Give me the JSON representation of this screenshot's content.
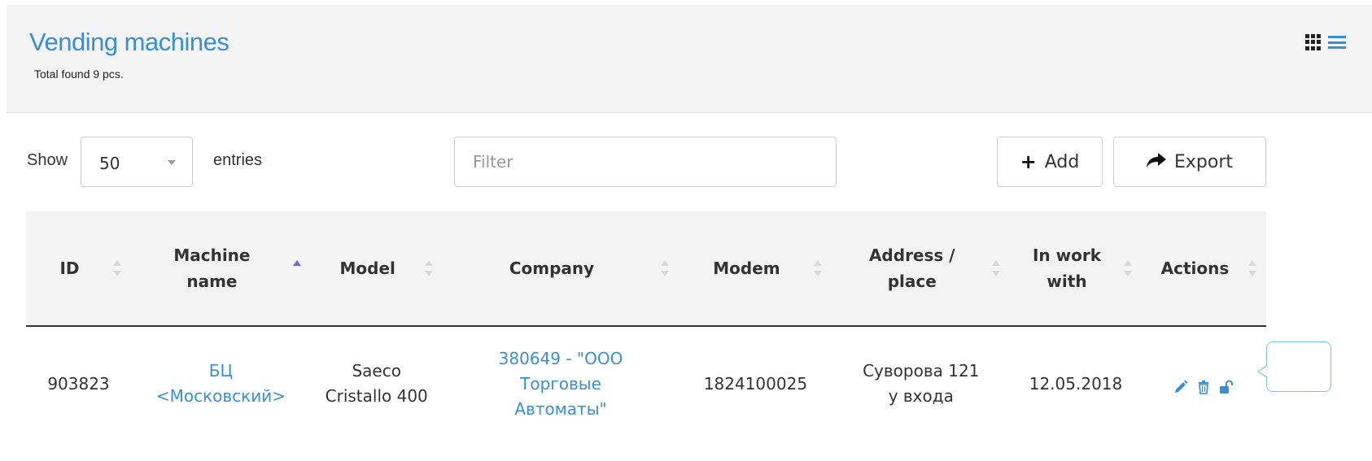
{
  "header": {
    "title": "Vending machines",
    "subtitle": "Total found 9 pcs.",
    "accent_color": "#3a8fd0"
  },
  "view_toggle": {
    "grid_icon": "grid-icon",
    "list_icon": "list-icon"
  },
  "toolbar": {
    "show_label": "Show",
    "page_size": "50",
    "entries_label": "entries",
    "filter_placeholder": "Filter",
    "add_label": "Add",
    "export_label": "Export"
  },
  "table": {
    "columns": [
      {
        "line1": "ID",
        "line2": "",
        "sort": "none"
      },
      {
        "line1": "Machine",
        "line2": "name",
        "sort": "asc"
      },
      {
        "line1": "Model",
        "line2": "",
        "sort": "none"
      },
      {
        "line1": "Company",
        "line2": "",
        "sort": "none"
      },
      {
        "line1": "Modem",
        "line2": "",
        "sort": "none"
      },
      {
        "line1": "Address /",
        "line2": "place",
        "sort": "none"
      },
      {
        "line1": "In work",
        "line2": "with",
        "sort": "none"
      },
      {
        "line1": "Actions",
        "line2": "",
        "sort": "none"
      }
    ],
    "rows": [
      {
        "id": "903823",
        "name_l1": "БЦ",
        "name_l2": "<Московский>",
        "model_l1": "Saeco",
        "model_l2": "Cristallo 400",
        "company_l1": "380649 - \"ООО",
        "company_l2": "Торговые",
        "company_l3": "Автоматы\"",
        "modem": "1824100025",
        "address_l1": "Суворова 121",
        "address_l2": "у входа",
        "in_work_with": "12.05.2018",
        "actions": [
          "pencil-icon",
          "trash-icon",
          "unlock-icon"
        ]
      }
    ]
  }
}
